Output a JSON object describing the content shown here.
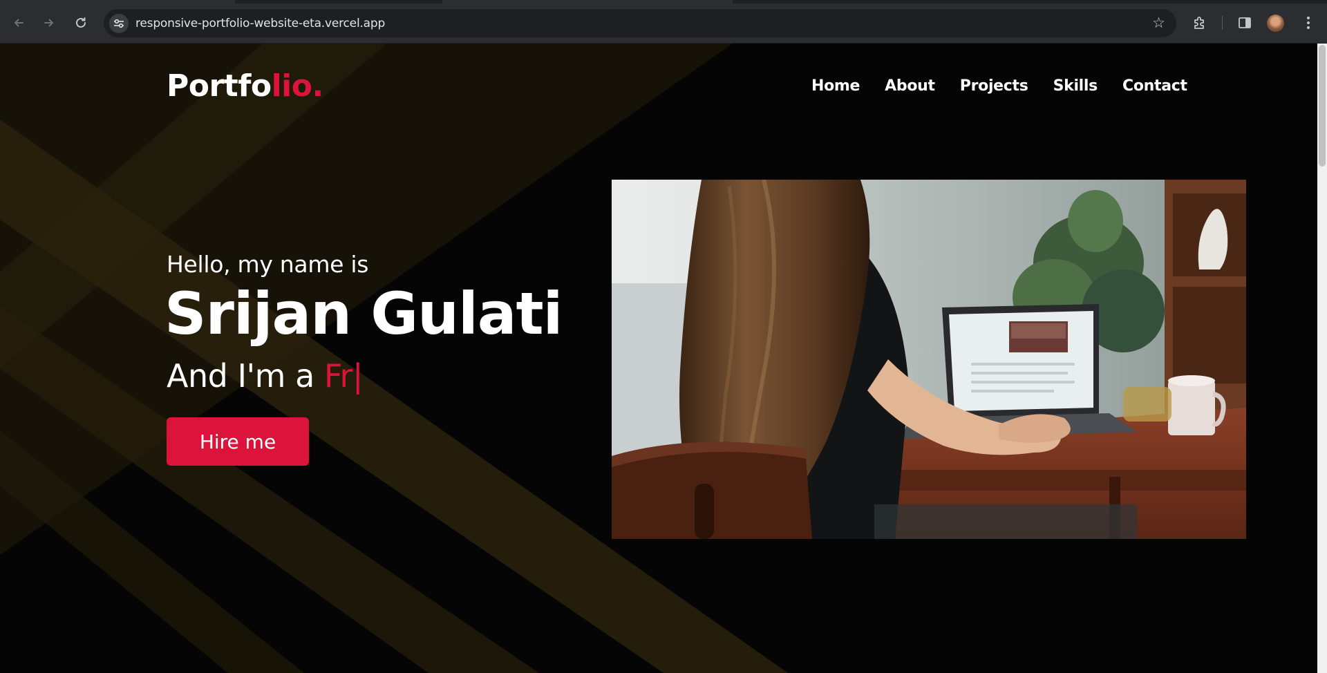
{
  "browser": {
    "url": "responsive-portfolio-website-eta.vercel.app",
    "icons": {
      "back": "arrow-left-icon",
      "forward": "arrow-right-icon",
      "reload": "reload-icon",
      "site_info": "site-settings-icon",
      "bookmark": "star-icon",
      "extensions": "puzzle-icon",
      "side_panel": "side-panel-icon",
      "menu": "kebab-menu-icon"
    }
  },
  "site": {
    "logo_main": "Portfo",
    "logo_accent": "lio.",
    "nav": [
      "Home",
      "About",
      "Projects",
      "Skills",
      "Contact"
    ]
  },
  "hero": {
    "greeting": "Hello, my name is",
    "name": "Srijan Gulati",
    "role_prefix": "And I'm a ",
    "role_typed": "Fr",
    "cursor": "|",
    "cta": "Hire me"
  },
  "colors": {
    "accent": "#dc143c",
    "background": "#050505",
    "text": "#ffffff",
    "chrome": "#2b2d31",
    "omnibox": "#1e1f22"
  }
}
